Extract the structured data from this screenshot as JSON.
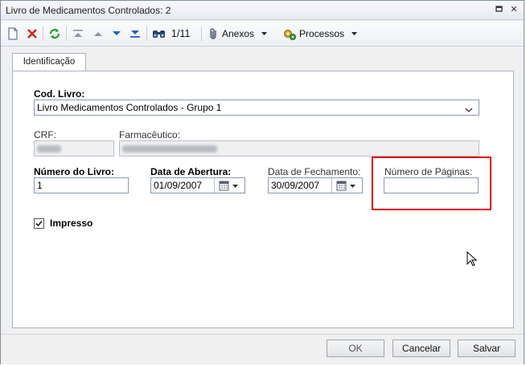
{
  "window": {
    "title": "Livro de Medicamentos Controlados: 2"
  },
  "title_buttons": [
    {
      "icon": "restore-icon"
    },
    {
      "icon": "close-icon",
      "label": "✕"
    }
  ],
  "toolbar": {
    "record_counter": "1/11",
    "attachments_label": "Anexos",
    "processes_label": "Processos"
  },
  "tabs": [
    {
      "label": "Identificação",
      "active": true
    }
  ],
  "form": {
    "cod_livro": {
      "label": "Cod. Livro:",
      "value": "Livro Medicamentos Controlados - Grupo 1"
    },
    "crf": {
      "label": "CRF:",
      "value": ""
    },
    "farmaceutico": {
      "label": "Farmacêutico:",
      "value": ""
    },
    "numero_livro": {
      "label": "Número do Livro:",
      "value": "1"
    },
    "data_abertura": {
      "label": "Data de Abertura:",
      "value": "01/09/2007"
    },
    "data_fechamento": {
      "label": "Data de Fechamento:",
      "value": "30/09/2007"
    },
    "numero_paginas": {
      "label": "Número de Páginas:",
      "value": ""
    },
    "impresso": {
      "label": "Impresso",
      "checked": true
    }
  },
  "footer": {
    "ok_label": "OK",
    "cancel_label": "Cancelar",
    "save_label": "Salvar"
  },
  "colors": {
    "highlight": "#e00000",
    "accent_blue": "#1e5fcc",
    "delete_red": "#d42020",
    "refresh_green": "#2a9a2a"
  }
}
